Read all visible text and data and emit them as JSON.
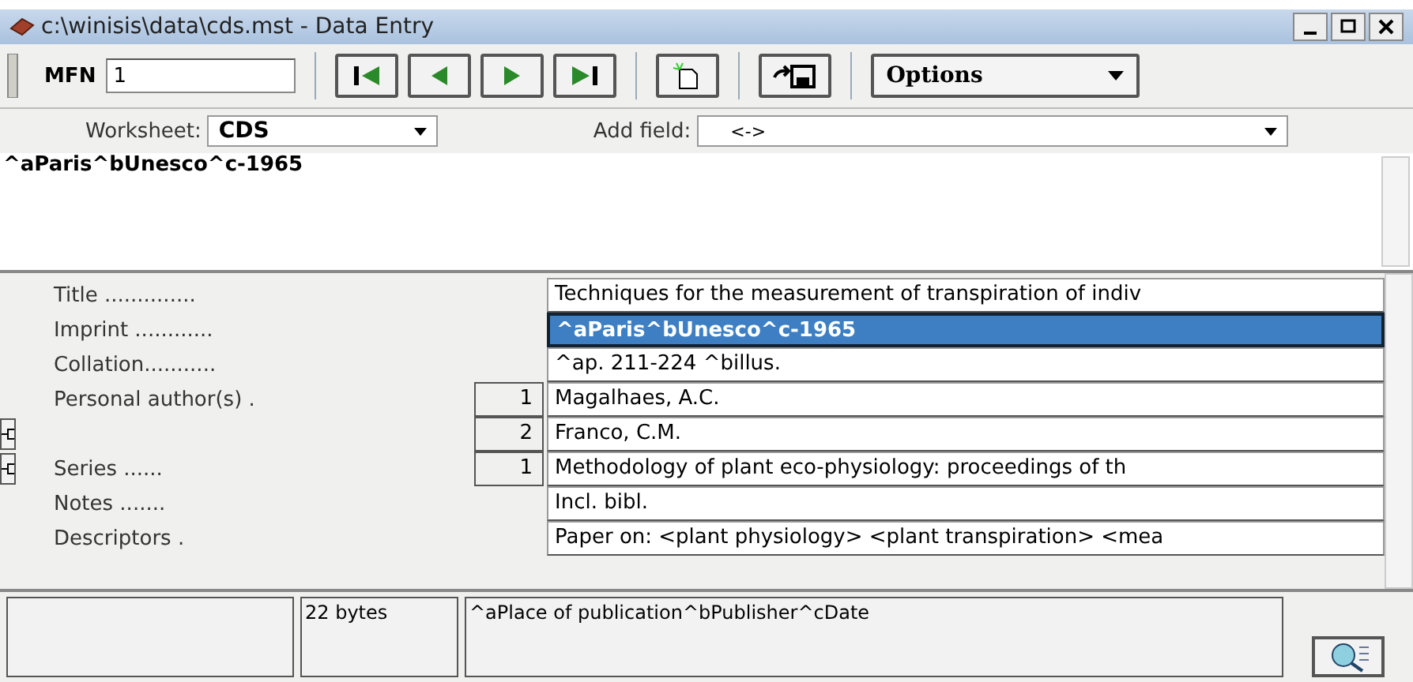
{
  "window": {
    "title": "c:\\winisis\\data\\cds.mst - Data Entry"
  },
  "toolbar": {
    "mfn_label": "MFN",
    "mfn_value": "1",
    "options": "Options"
  },
  "worksheet": {
    "label": "Worksheet:",
    "value": "CDS"
  },
  "add_field": {
    "label": "Add field:",
    "value": "<->"
  },
  "editor": {
    "value": "^aParis^bUnesco^c-1965"
  },
  "fields": [
    {
      "label": "Title ..............",
      "value": "Techniques for the measurement of transpiration of indiv",
      "selected": false,
      "add_button": false
    },
    {
      "label": "Imprint ............",
      "value": "^aParis^bUnesco^c-1965",
      "selected": true,
      "add_button": false
    },
    {
      "label": "Collation...........",
      "value": "^ap. 211-224 ^billus.",
      "selected": false,
      "add_button": false
    },
    {
      "label": "Personal author(s) .",
      "occurrence": "1",
      "value": "Magalhaes, A.C.",
      "selected": false,
      "add_button": false
    },
    {
      "occurrence": "2",
      "value": "Franco, C.M.",
      "selected": false,
      "add_button": true
    },
    {
      "label": "Series ......",
      "occurrence": "1",
      "value": "Methodology of plant eco-physiology: proceedings of th",
      "selected": false,
      "add_button": true
    },
    {
      "label": "Notes .......",
      "value": "Incl. bibl.",
      "selected": false,
      "add_button": false
    },
    {
      "label": "Descriptors .",
      "value": "Paper on: <plant physiology> <plant transpiration> <mea",
      "selected": false,
      "add_button": false
    }
  ],
  "status": {
    "size": "22 bytes",
    "hint": "^aPlace of publication^bPublisher^cDate"
  }
}
